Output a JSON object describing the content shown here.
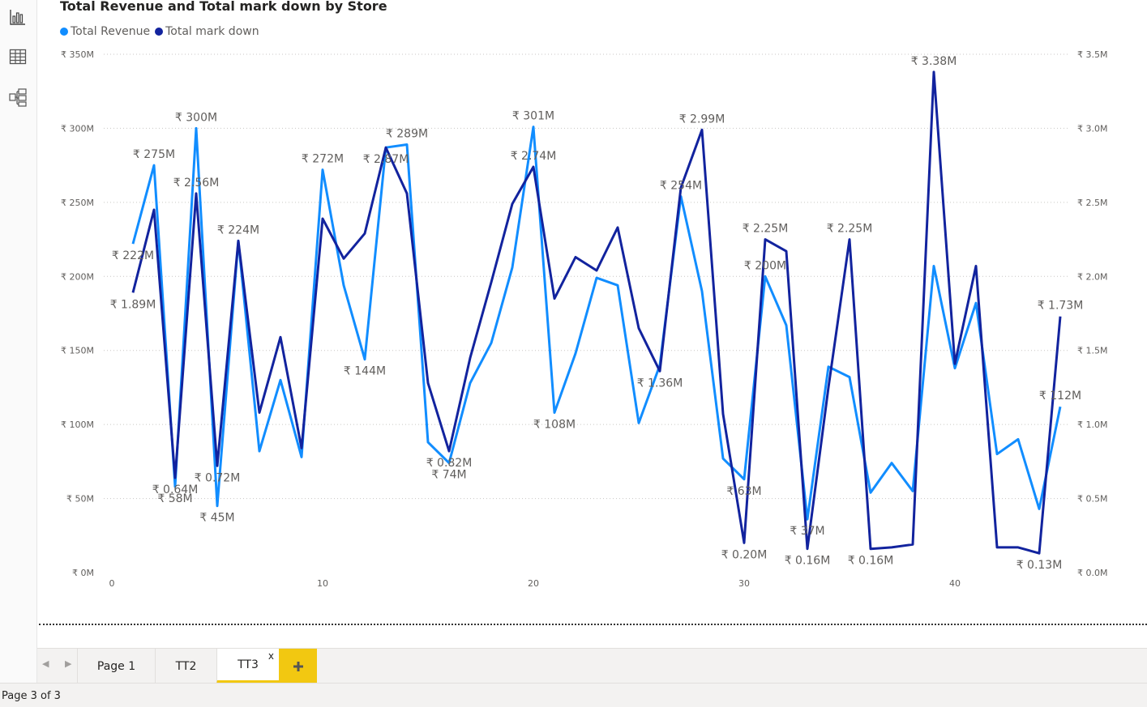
{
  "chart_data": {
    "type": "line",
    "title": "Total Revenue and Total mark down by Store",
    "legend": {
      "position": "top-left"
    },
    "x": [
      1,
      2,
      3,
      4,
      5,
      6,
      7,
      8,
      9,
      10,
      11,
      12,
      13,
      14,
      15,
      16,
      17,
      18,
      19,
      20,
      21,
      22,
      23,
      24,
      25,
      26,
      27,
      28,
      29,
      30,
      31,
      32,
      33,
      34,
      35,
      36,
      37,
      38,
      39,
      40,
      41,
      42,
      43,
      44,
      45
    ],
    "x_ticks": [
      "0",
      "10",
      "20",
      "30",
      "40"
    ],
    "x_range": [
      0,
      45
    ],
    "y_left": {
      "ticks": [
        "₹ 0M",
        "₹ 50M",
        "₹ 100M",
        "₹ 150M",
        "₹ 200M",
        "₹ 250M",
        "₹ 300M",
        "₹ 350M"
      ],
      "range": [
        0,
        350
      ]
    },
    "y_right": {
      "ticks": [
        "₹ 0.0M",
        "₹ 0.5M",
        "₹ 1.0M",
        "₹ 1.5M",
        "₹ 2.0M",
        "₹ 2.5M",
        "₹ 3.0M",
        "₹ 3.5M"
      ],
      "range": [
        0,
        3.5
      ]
    },
    "grid": true,
    "series": [
      {
        "name": "Total Revenue",
        "axis": "left",
        "color": "#118dff",
        "values": [
          222,
          275,
          58,
          300,
          45,
          224,
          82,
          130,
          78,
          272,
          194,
          144,
          287,
          289,
          88,
          74,
          128,
          155,
          206,
          301,
          108,
          148,
          199,
          194,
          101,
          140,
          254,
          190,
          77,
          63,
          200,
          167,
          36,
          139,
          132,
          54,
          74,
          55,
          207,
          138,
          182,
          80,
          90,
          43,
          112
        ]
      },
      {
        "name": "Total mark down",
        "axis": "right",
        "color": "#12239e",
        "values": [
          1.89,
          2.45,
          0.64,
          2.56,
          0.72,
          2.24,
          1.08,
          1.59,
          0.84,
          2.39,
          2.12,
          2.29,
          2.87,
          2.56,
          1.28,
          0.82,
          1.45,
          1.96,
          2.49,
          2.74,
          1.85,
          2.13,
          2.04,
          2.33,
          1.65,
          1.36,
          2.6,
          2.99,
          1.07,
          0.2,
          2.25,
          2.17,
          0.16,
          1.25,
          2.25,
          0.16,
          0.17,
          0.19,
          3.38,
          1.41,
          2.07,
          0.17,
          0.17,
          0.13,
          1.73
        ]
      }
    ],
    "annotations": [
      {
        "series": 0,
        "x": 1,
        "text": "₹ 222M",
        "pos": "below"
      },
      {
        "series": 0,
        "x": 2,
        "text": "₹ 275M",
        "pos": "above"
      },
      {
        "series": 0,
        "x": 3,
        "text": "₹ 58M",
        "pos": "below"
      },
      {
        "series": 0,
        "x": 4,
        "text": "₹ 300M",
        "pos": "above"
      },
      {
        "series": 0,
        "x": 5,
        "text": "₹ 45M",
        "pos": "below"
      },
      {
        "series": 0,
        "x": 6,
        "text": "₹ 224M",
        "pos": "above"
      },
      {
        "series": 0,
        "x": 10,
        "text": "₹ 272M",
        "pos": "above"
      },
      {
        "series": 0,
        "x": 12,
        "text": "₹ 144M",
        "pos": "below"
      },
      {
        "series": 0,
        "x": 14,
        "text": "₹ 289M",
        "pos": "above"
      },
      {
        "series": 0,
        "x": 16,
        "text": "₹ 74M",
        "pos": "below"
      },
      {
        "series": 0,
        "x": 20,
        "text": "₹ 301M",
        "pos": "above"
      },
      {
        "series": 0,
        "x": 21,
        "text": "₹ 108M",
        "pos": "below"
      },
      {
        "series": 0,
        "x": 27,
        "text": "₹ 254M",
        "pos": "above"
      },
      {
        "series": 0,
        "x": 30,
        "text": "₹ 63M",
        "pos": "below"
      },
      {
        "series": 0,
        "x": 31,
        "text": "₹ 200M",
        "pos": "above"
      },
      {
        "series": 0,
        "x": 33,
        "text": "₹ 37M",
        "pos": "below"
      },
      {
        "series": 0,
        "x": 45,
        "text": "₹ 112M",
        "pos": "above"
      },
      {
        "series": 1,
        "x": 1,
        "text": "₹ 1.89M",
        "pos": "below"
      },
      {
        "series": 1,
        "x": 3,
        "text": "₹ 0.64M",
        "pos": "below"
      },
      {
        "series": 1,
        "x": 4,
        "text": "₹ 2.56M",
        "pos": "above"
      },
      {
        "series": 1,
        "x": 5,
        "text": "₹ 0.72M",
        "pos": "below"
      },
      {
        "series": 1,
        "x": 13,
        "text": "₹ 2.87M",
        "pos": "below"
      },
      {
        "series": 1,
        "x": 16,
        "text": "₹ 0.82M",
        "pos": "below"
      },
      {
        "series": 1,
        "x": 20,
        "text": "₹ 2.74M",
        "pos": "above"
      },
      {
        "series": 1,
        "x": 26,
        "text": "₹ 1.36M",
        "pos": "below"
      },
      {
        "series": 1,
        "x": 28,
        "text": "₹ 2.99M",
        "pos": "above"
      },
      {
        "series": 1,
        "x": 30,
        "text": "₹ 0.20M",
        "pos": "below"
      },
      {
        "series": 1,
        "x": 31,
        "text": "₹ 2.25M",
        "pos": "above"
      },
      {
        "series": 1,
        "x": 33,
        "text": "₹ 0.16M",
        "pos": "below"
      },
      {
        "series": 1,
        "x": 35,
        "text": "₹ 2.25M",
        "pos": "above"
      },
      {
        "series": 1,
        "x": 36,
        "text": "₹ 0.16M",
        "pos": "below"
      },
      {
        "series": 1,
        "x": 39,
        "text": "₹ 3.38M",
        "pos": "above"
      },
      {
        "series": 1,
        "x": 44,
        "text": "₹ 0.13M",
        "pos": "below"
      },
      {
        "series": 1,
        "x": 45,
        "text": "₹ 1.73M",
        "pos": "above"
      }
    ]
  },
  "sidebar": {
    "icons": [
      "report-view-icon",
      "data-view-icon",
      "model-view-icon"
    ]
  },
  "tabs": {
    "items": [
      {
        "label": "Page 1"
      },
      {
        "label": "TT2"
      },
      {
        "label": "TT3"
      }
    ],
    "close_glyph": "x",
    "add_glyph": "+",
    "prev_glyph": "◀",
    "next_glyph": "▶",
    "active_color": "#f2c811"
  },
  "status": {
    "page_indicator": "Page 3 of 3"
  }
}
